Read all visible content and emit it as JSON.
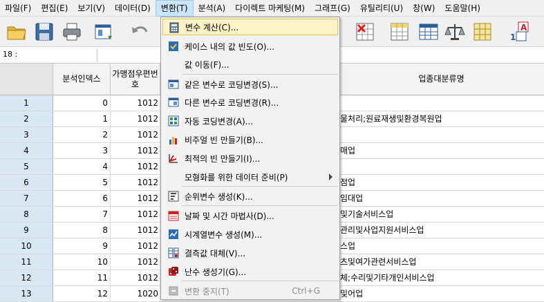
{
  "menubar": {
    "items": [
      "파일(F)",
      "편집(E)",
      "보기(V)",
      "데이터(D)",
      "변환(T)",
      "분석(A)",
      "다이렉트 마케팅(M)",
      "그래프(G)",
      "유틸리티(U)",
      "창(W)",
      "도움말(H)"
    ]
  },
  "refbar": {
    "cell_ref": "18 :"
  },
  "grid": {
    "headers": {
      "col1": "분석인덱스",
      "col2": "가맹점우편번호",
      "col3": "업종대분류명"
    },
    "rows": [
      {
        "n": "1",
        "a": "0",
        "b": "1012",
        "c": ""
      },
      {
        "n": "2",
        "a": "1",
        "b": "1012",
        "c": "물처리;원료재생및환경복원업"
      },
      {
        "n": "3",
        "a": "2",
        "b": "1012",
        "c": ""
      },
      {
        "n": "4",
        "a": "3",
        "b": "1012",
        "c": "매업"
      },
      {
        "n": "5",
        "a": "4",
        "b": "1012",
        "c": ""
      },
      {
        "n": "6",
        "a": "5",
        "b": "1012",
        "c": "점업"
      },
      {
        "n": "7",
        "a": "6",
        "b": "1012",
        "c": "임대업"
      },
      {
        "n": "8",
        "a": "7",
        "b": "1012",
        "c": "및기술서비스업"
      },
      {
        "n": "9",
        "a": "8",
        "b": "1012",
        "c": "관리및사업지원서비스업"
      },
      {
        "n": "10",
        "a": "9",
        "b": "1012",
        "c": "스업"
      },
      {
        "n": "11",
        "a": "10",
        "b": "1012",
        "c": "츠및여가관련서비스업"
      },
      {
        "n": "12",
        "a": "11",
        "b": "1012",
        "c": "체;수리및기타개인서비스업"
      },
      {
        "n": "13",
        "a": "12",
        "b": "1020",
        "c": "및어업"
      }
    ]
  },
  "dropdown": {
    "items": [
      {
        "label": "변수 계산(C)...",
        "icon": "calculator-icon"
      },
      {
        "label": "케이스 내의 값 빈도(O)...",
        "icon": "count-values-icon"
      },
      {
        "label": "값 이동(F)...",
        "icon": ""
      },
      {
        "label": "같은 변수로 코딩변경(S)...",
        "icon": "recode-same-icon"
      },
      {
        "label": "다른 변수로 코딩변경(R)...",
        "icon": "recode-different-icon"
      },
      {
        "label": "자동 코딩변경(A)...",
        "icon": "automatic-recode-icon"
      },
      {
        "label": "비주얼 빈 만들기(B)...",
        "icon": "visual-binning-icon"
      },
      {
        "label": "최적의 빈 만들기(I)...",
        "icon": "optimal-binning-icon"
      },
      {
        "label": "모형화를 위한 데이터 준비(P)",
        "icon": ""
      },
      {
        "label": "순위변수 생성(K)...",
        "icon": "rank-cases-icon"
      },
      {
        "label": "날짜 및 시간 마법사(D)...",
        "icon": "date-time-wizard-icon"
      },
      {
        "label": "시계열변수 생성(M)...",
        "icon": "time-series-icon"
      },
      {
        "label": "결측값 대체(V)...",
        "icon": "replace-missing-icon"
      },
      {
        "label": "난수 생성기(G)...",
        "icon": "dice-icon"
      },
      {
        "label": "변환 중지(T)",
        "icon": "stop-icon",
        "shortcut": "Ctrl+G"
      }
    ]
  }
}
